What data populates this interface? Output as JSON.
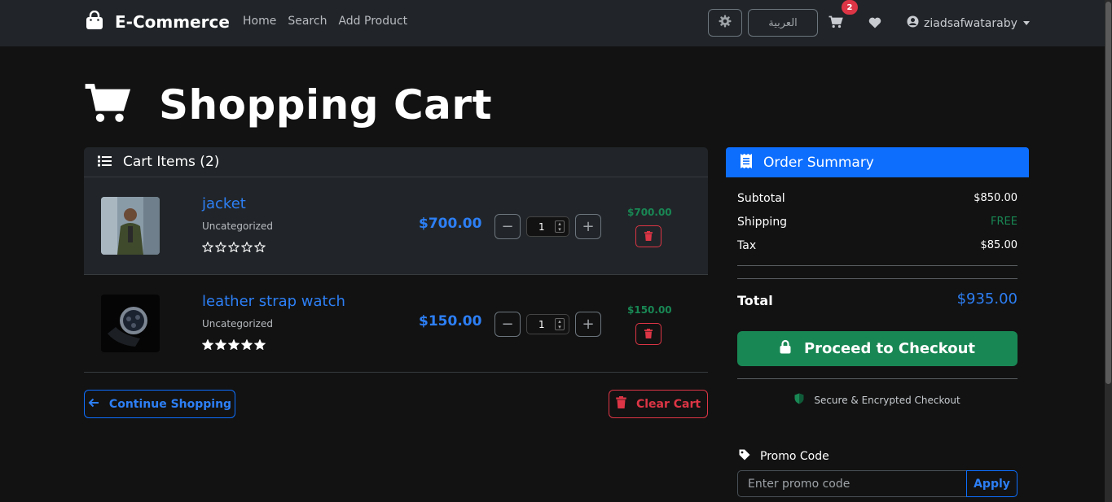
{
  "navbar": {
    "brand": "E-Commerce",
    "links": [
      "Home",
      "Search",
      "Add Product"
    ],
    "language_button": "العربية",
    "cart_count": "2",
    "username": "ziadsafwataraby"
  },
  "page": {
    "title": "Shopping Cart"
  },
  "cart": {
    "header": "Cart Items (2)",
    "items": [
      {
        "name": "jacket",
        "category": "Uncategorized",
        "price": "$700.00",
        "quantity": "1",
        "total": "$700.00",
        "rating": 0
      },
      {
        "name": "leather strap watch",
        "category": "Uncategorized",
        "price": "$150.00",
        "quantity": "1",
        "total": "$150.00",
        "rating": 5
      }
    ],
    "continue_label": "Continue Shopping",
    "clear_label": "Clear Cart"
  },
  "summary": {
    "title": "Order Summary",
    "subtotal_label": "Subtotal",
    "subtotal": "$850.00",
    "shipping_label": "Shipping",
    "shipping": "FREE",
    "tax_label": "Tax",
    "tax": "$85.00",
    "total_label": "Total",
    "total": "$935.00",
    "checkout_label": "Proceed to Checkout",
    "secure_text": "Secure & Encrypted Checkout",
    "promo_label": "Promo Code",
    "promo_placeholder": "Enter promo code",
    "apply_label": "Apply"
  },
  "colors": {
    "primary": "#0d6efd",
    "success": "#198754",
    "danger": "#dc3545",
    "navbar": "#212529",
    "background": "#121212"
  },
  "icons": [
    "shopping-bag-icon",
    "gear-icon",
    "cart-icon",
    "heart-icon",
    "user-circle-icon",
    "list-icon",
    "receipt-icon",
    "trash-icon",
    "arrow-left-icon",
    "lock-icon",
    "shield-icon",
    "tag-icon",
    "star-icon"
  ]
}
